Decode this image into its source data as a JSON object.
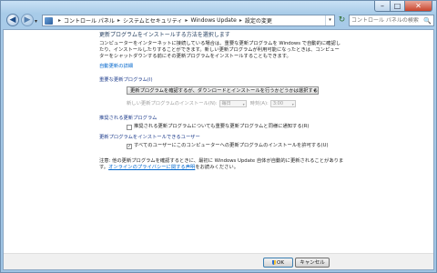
{
  "window": {
    "minimize": "–",
    "maximize": "□",
    "close": "✕"
  },
  "nav": {
    "back": "◀",
    "forward": "▶",
    "dropdown": "▾"
  },
  "address": {
    "breadcrumb": [
      "コントロール パネル",
      "システムとセキュリティ",
      "Windows Update",
      "設定の変更"
    ],
    "separator": "▸",
    "dropdown": "▾"
  },
  "refresh_glyph": "↻",
  "search": {
    "placeholder": "コントロール パネルの検索",
    "icon_glyph": "🔍"
  },
  "main": {
    "heading": "更新プログラムをインストールする方法を選択します",
    "intro": "コンピューターをインターネットに接続している場合は、重要な更新プログラムを Windows で自動的に確認したり、インストールしたりすることができます。新しい更新プログラムが利用可能になったときは、コンピューターをシャットダウンする前にその更新プログラムをインストールすることもできます。",
    "autolink": "自動更新の詳細",
    "important_header": "重要な更新プログラム(I)",
    "important_value": "更新プログラムを確認するが、ダウンロードとインストールを行うかどうかは選択する",
    "schedule": {
      "label": "新しい更新プログラムのインストール(N):",
      "day": "毎日",
      "time_label": "時刻(A):",
      "time": "3:00"
    },
    "recommended_header": "推奨される更新プログラム",
    "recommended_check": "推奨される更新プログラムについても重要な更新プログラムと同様に通知する(R)",
    "who_header": "更新プログラムをインストールできるユーザー",
    "who_check": "すべてのユーザーにこのコンピューターへの更新プログラムのインストールを許可する(U)",
    "notes_prefix": "注意: 他の更新プログラムを確認するときに、最初に Windows Update 自体が自動的に更新されることがあります。",
    "notes_link": "オンラインのプライバシーに関する声明",
    "notes_suffix": "をお読みください。"
  },
  "checked_mark": "✓",
  "buttons": {
    "ok": "OK",
    "cancel": "キャンセル"
  }
}
